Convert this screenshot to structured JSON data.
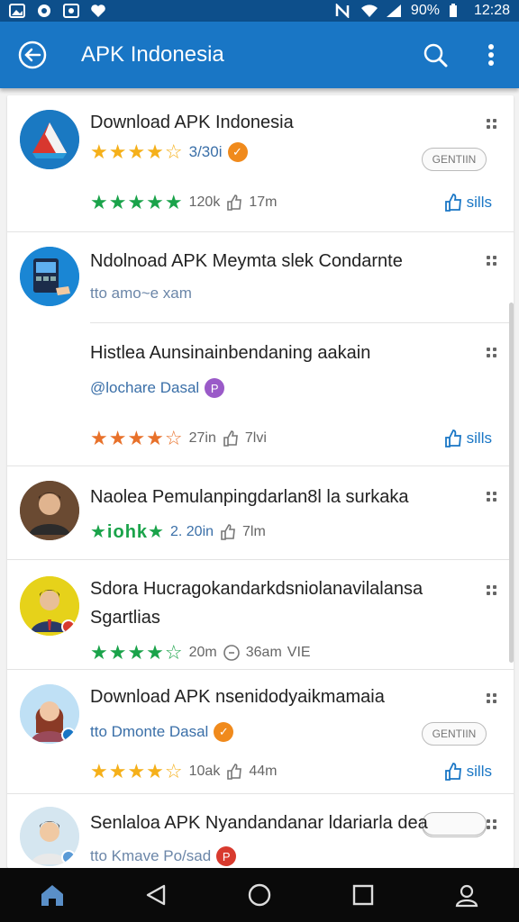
{
  "statusbar": {
    "battery": "90%",
    "time": "12:28"
  },
  "appbar": {
    "title": "APK Indonesia"
  },
  "items": [
    {
      "name": "Download APK Indonesia",
      "rating_text": "3/30i",
      "stars": "★★★★☆",
      "reviews_stars": "★★★★★",
      "reviews": "120k",
      "likes_meta": "17m",
      "action": "GENTIIN",
      "like_label": "sills"
    },
    {
      "name": "Ndolnoad APK Meymta slek Condarnte",
      "sub": "tto amo~e xam"
    },
    {
      "name": "Histlea Aunsinainbendaning aakain",
      "sub": "@lochare Dasal",
      "stars": "★★★★☆",
      "reviews": "27in",
      "likes_meta": "7lvi",
      "like_label": "sills"
    },
    {
      "name": "Naolea Pemulanpingdarlan8l la surkaka",
      "stars": "★iohk★",
      "reviews": "2. 20in",
      "likes_meta": "7lm"
    },
    {
      "name": "Sdora Hucragokandarkdsniolanavilalansa Sgartlias",
      "stars": "★★★★☆",
      "reviews": "20m",
      "likes_meta": "36am",
      "extra": "VIE"
    },
    {
      "name": "Download APK nsenidodyaikmamaia",
      "sub": "tto Dmonte Dasal",
      "stars": "★★★★☆",
      "reviews": "10ak",
      "likes_meta": "44m",
      "action": "GENTIIN",
      "like_label": "sills"
    },
    {
      "name": "Senlaloa APK Nyandandanar ldariarla dea",
      "sub": "tto Kmave Po/sad"
    }
  ],
  "colors": {
    "appbar": "#1976c5",
    "statusbar": "#0d4f8b",
    "star_gold": "#f5b01a",
    "star_green": "#1aa34a",
    "star_orange": "#e8712a",
    "link": "#3a6fa8"
  }
}
